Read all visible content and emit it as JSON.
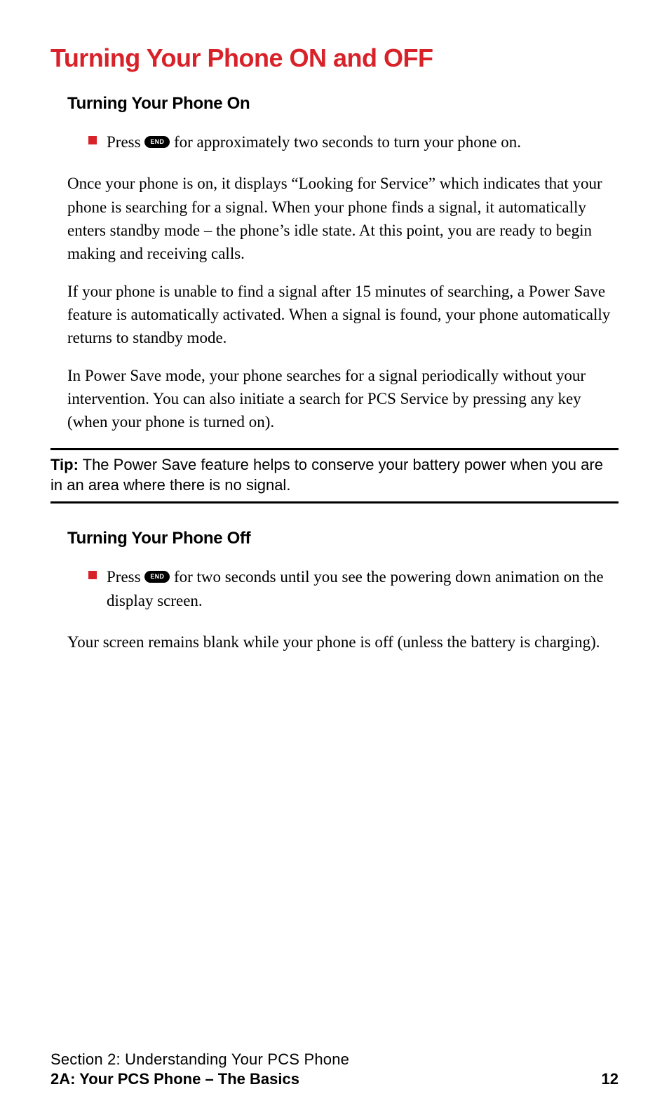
{
  "heading1": "Turning Your Phone ON and OFF",
  "section_on": {
    "heading": "Turning Your Phone On",
    "bullet_pre": "Press ",
    "badge": "END",
    "bullet_post": " for approximately two seconds to turn your phone on.",
    "para1": "Once your phone is on, it displays “Looking for Service” which indicates that your phone is searching for a signal. When your phone finds a signal, it automatically enters standby mode – the phone’s idle state. At this point, you are ready to begin making and receiving calls.",
    "para2": "If your phone is unable to find a signal after 15 minutes of searching, a Power Save feature is automatically activated. When a signal is found, your phone automatically returns to standby mode.",
    "para3": "In Power Save mode, your phone searches for a signal periodically without your intervention. You can also initiate a search for PCS Service by pressing any key (when your phone is turned on)."
  },
  "tip": {
    "label": "Tip:",
    "text": " The Power Save feature helps to conserve your battery power when you are in an area where there is no signal."
  },
  "section_off": {
    "heading": "Turning Your Phone Off",
    "bullet_pre": "Press ",
    "badge": "END",
    "bullet_post": " for two seconds until you see the powering down animation on the display screen.",
    "para1": "Your screen remains blank while your phone is off (unless the battery is charging)."
  },
  "footer": {
    "line1": "Section 2: Understanding Your PCS Phone",
    "line2": "2A: Your PCS Phone – The Basics",
    "page": "12"
  }
}
